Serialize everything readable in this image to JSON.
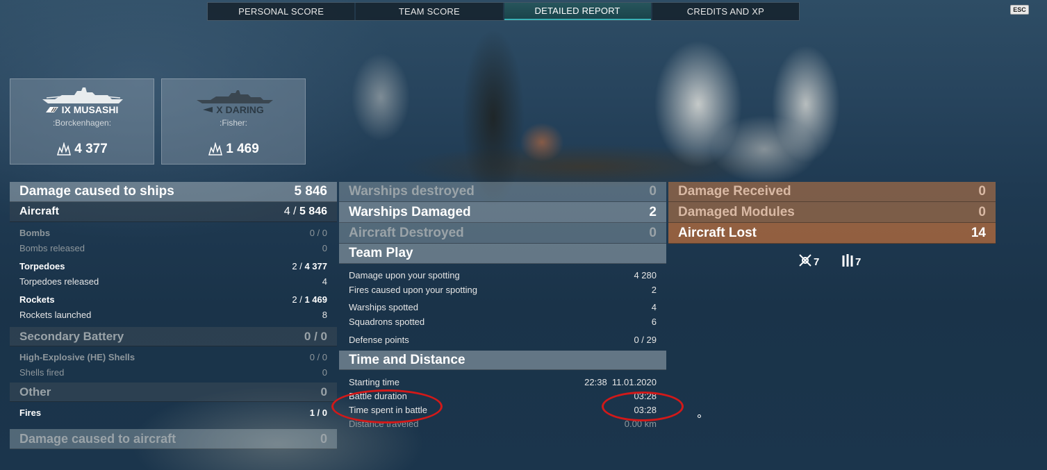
{
  "tabs": [
    "PERSONAL SCORE",
    "TEAM SCORE",
    "DETAILED REPORT",
    "CREDITS AND XP"
  ],
  "esc_label": "ESC",
  "ships": [
    {
      "tier_name": "IX MUSASHI",
      "player": ":Borckenhagen:",
      "damage": "4 377"
    },
    {
      "tier_name": "X DARING",
      "player": ":Fisher:",
      "damage": "1 469"
    }
  ],
  "left": {
    "damage_ships": {
      "label": "Damage caused to ships",
      "value": "5 846"
    },
    "aircraft": {
      "label": "Aircraft",
      "count": "4 /",
      "value": "5 846"
    },
    "bombs": {
      "label": "Bombs",
      "value": "0 / 0"
    },
    "bombs_released": {
      "label": "Bombs released",
      "value": "0"
    },
    "torpedoes": {
      "label": "Torpedoes",
      "count": "2 /",
      "value": "4 377"
    },
    "torpedoes_released": {
      "label": "Torpedoes released",
      "value": "4"
    },
    "rockets": {
      "label": "Rockets",
      "count": "2 /",
      "value": "1 469"
    },
    "rockets_launched": {
      "label": "Rockets launched",
      "value": "8"
    },
    "secondary": {
      "label": "Secondary Battery",
      "value": "0 / 0"
    },
    "he_shells": {
      "label": "High-Explosive (HE) Shells",
      "value": "0 / 0"
    },
    "shells_fired": {
      "label": "Shells fired",
      "value": "0"
    },
    "other": {
      "label": "Other",
      "value": "0"
    },
    "fires": {
      "label": "Fires",
      "value": "1 / 0"
    },
    "damage_aircraft": {
      "label": "Damage caused to aircraft",
      "value": "0"
    }
  },
  "middle": {
    "warships_destroyed": {
      "label": "Warships destroyed",
      "value": "0"
    },
    "warships_damaged": {
      "label": "Warships Damaged",
      "value": "2"
    },
    "aircraft_destroyed": {
      "label": "Aircraft Destroyed",
      "value": "0"
    },
    "team_play": {
      "label": "Team Play"
    },
    "damage_spotting": {
      "label": "Damage upon your spotting",
      "value": "4 280"
    },
    "fires_spotting": {
      "label": "Fires caused upon your spotting",
      "value": "2"
    },
    "warships_spotted": {
      "label": "Warships spotted",
      "value": "4"
    },
    "squadrons_spotted": {
      "label": "Squadrons spotted",
      "value": "6"
    },
    "defense_points": {
      "label": "Defense points",
      "value": "0 / 29"
    },
    "time_distance": {
      "label": "Time and Distance"
    },
    "starting_time": {
      "label": "Starting time",
      "value": "22:38  11.01.2020"
    },
    "battle_duration": {
      "label": "Battle duration",
      "value": "03:28"
    },
    "time_spent": {
      "label": "Time spent in battle",
      "value": "03:28"
    },
    "distance": {
      "label": "Distance traveled",
      "value": "0.00 km"
    }
  },
  "right": {
    "damage_received": {
      "label": "Damage Received",
      "value": "0"
    },
    "damaged_modules": {
      "label": "Damaged Modules",
      "value": "0"
    },
    "aircraft_lost": {
      "label": "Aircraft Lost",
      "value": "14"
    },
    "icon_a_count": "7",
    "icon_b_count": "7"
  }
}
